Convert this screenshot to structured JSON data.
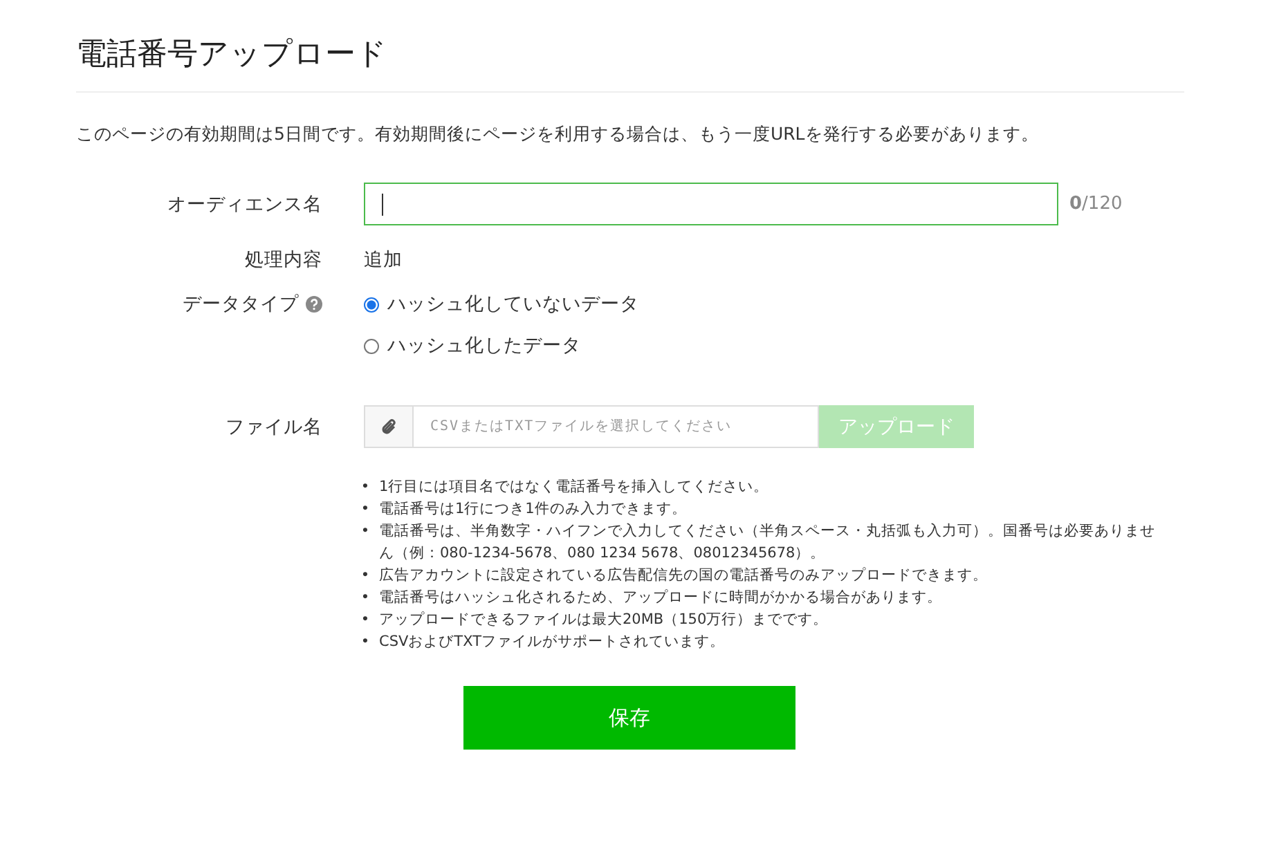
{
  "title": "電話番号アップロード",
  "notice": "このページの有効期間は5日間です。有効期間後にページを利用する場合は、もう一度URLを発行する必要があります。",
  "audience_name": {
    "label": "オーディエンス名",
    "focused": true,
    "counter": "**0**/120"
  },
  "process": {
    "label": "処理内容",
    "value": "追加"
  },
  "data_type": {
    "label": "データタイプ",
    "options": [
      {
        "label": "ハッシュ化していないデータ",
        "selected": true
      },
      {
        "label": "ハッシュ化したデータ",
        "selected": false
      }
    ]
  },
  "file": {
    "label": "ファイル名",
    "placeholder": "CSVまたはTXTファイルを選択してください",
    "upload_button": {
      "label": "アップロード",
      "disabled": true
    }
  },
  "notes": [
    {
      "bullet": "•",
      "text": "1行目には項目名ではなく電話番号を挿入してください。"
    },
    {
      "bullet": "•",
      "text": "電話番号は1行につき1件のみ入力できます。"
    },
    {
      "bullet": "•",
      "text": "電話番号は、半角数字・ハイフンで入力してください（半角スペース・丸括弧も入力可）。国番号は必要ありません（例：080-1234-5678、080 1234 5678、08012345678）。"
    },
    {
      "bullet": "•",
      "text": "広告アカウントに設定されている広告配信先の国の電話番号のみアップロードできます。"
    },
    {
      "bullet": "•",
      "text": "電話番号はハッシュ化されるため、アップロードに時間がかかる場合があります。"
    },
    {
      "bullet": "•",
      "text": "アップロードできるファイルは最大20MB（150万行）までです。"
    },
    {
      "bullet": "•",
      "text": "CSVおよびTXTファイルがサポートされています。"
    }
  ],
  "save_button": "保存"
}
